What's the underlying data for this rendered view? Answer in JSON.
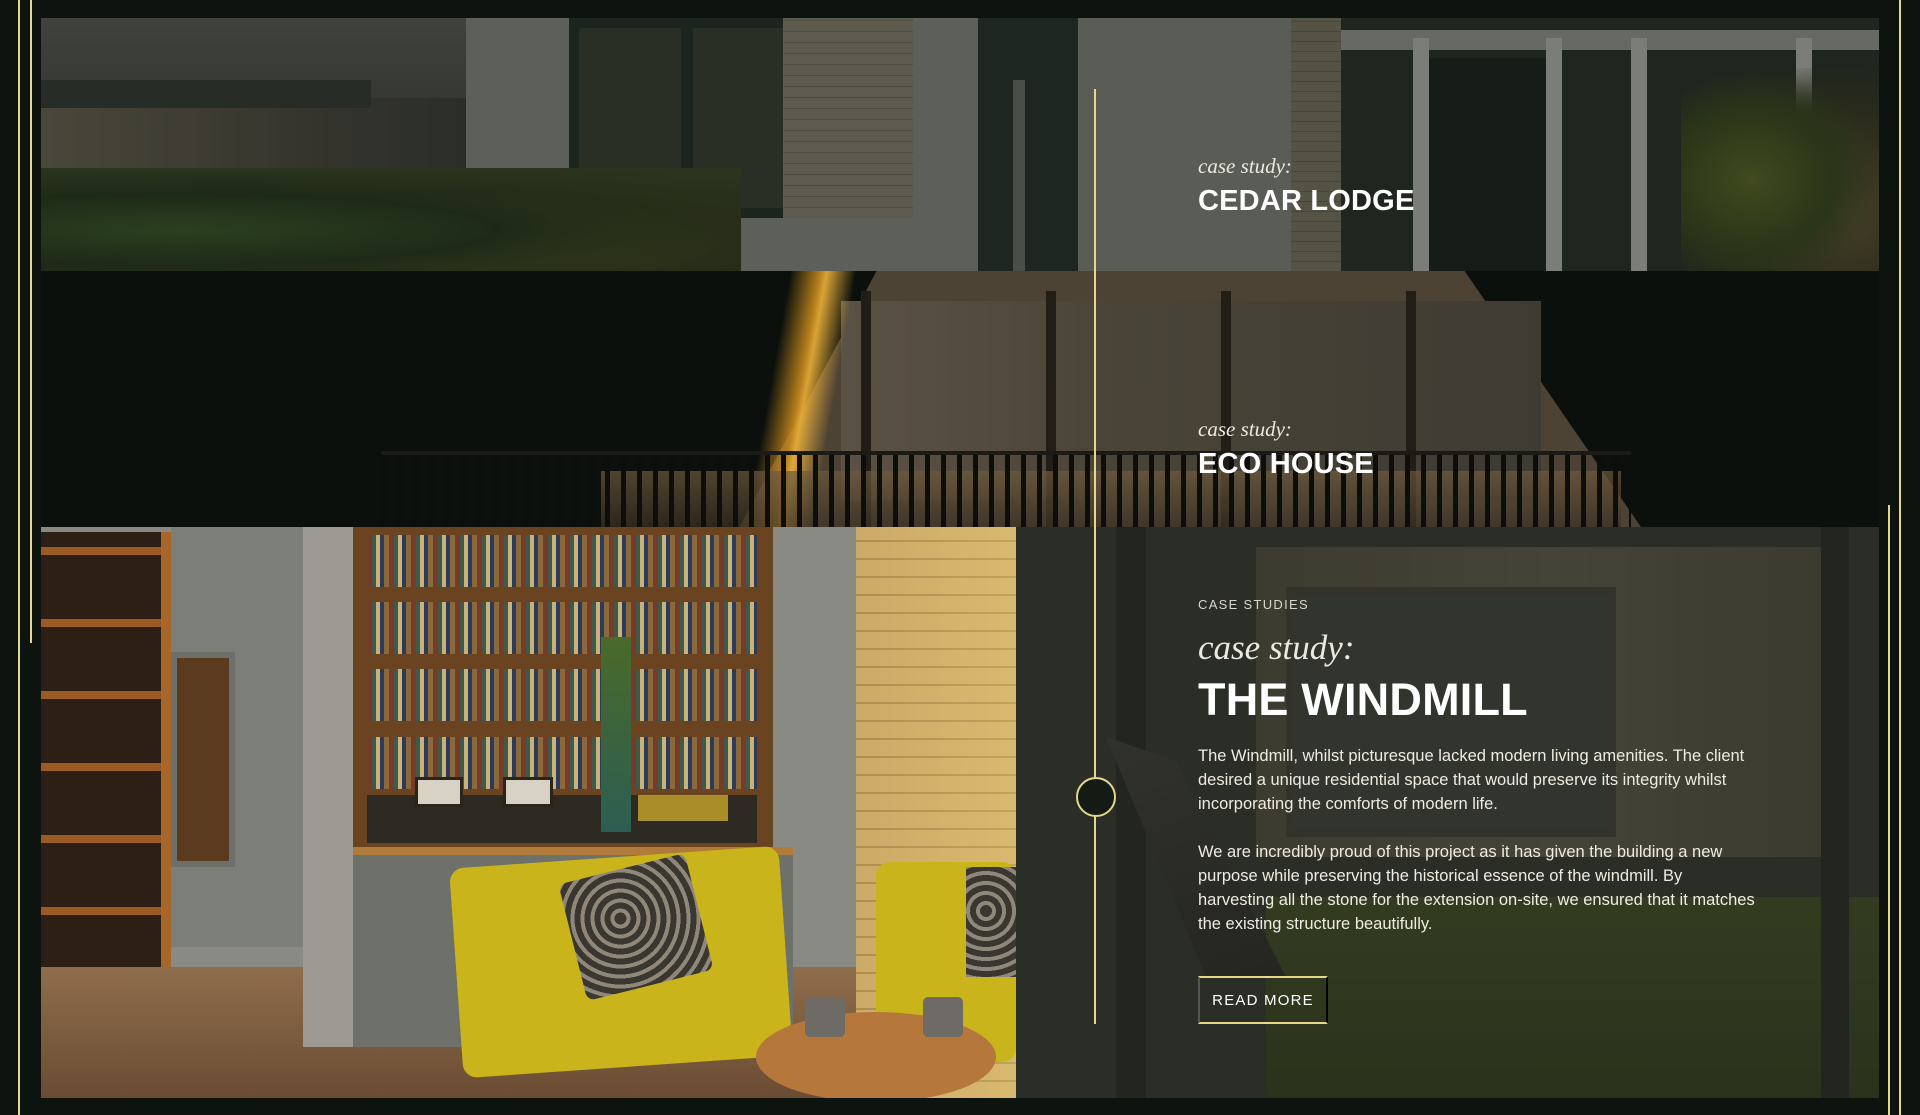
{
  "case_studies": [
    {
      "label": "case study:",
      "title": "CEDAR LODGE"
    },
    {
      "label": "case study:",
      "title": "ECO HOUSE"
    }
  ],
  "featured": {
    "eyebrow": "CASE STUDIES",
    "label": "case study:",
    "title": "THE WINDMILL",
    "paragraph_1": "The Windmill, whilst picturesque lacked modern living amenities. The client desired a unique residential space that would preserve its integrity whilst incorporating the comforts of modern life.",
    "paragraph_2": "We are incredibly proud of this project as it has given the building a new purpose while preserving the historical essence of the windmill. By harvesting all the stone for the extension on-site, we ensured that it matches the existing structure beautifully.",
    "cta_label": "READ MORE"
  },
  "colors": {
    "background": "#0d130e",
    "accent": "#e6d88a",
    "text": "#ffffff"
  }
}
